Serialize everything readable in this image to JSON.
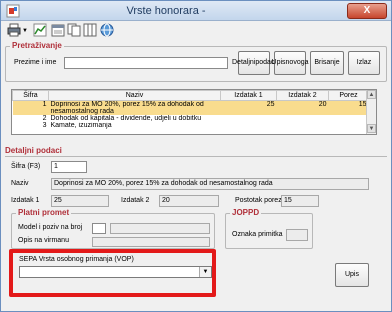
{
  "window": {
    "title": "Vrste honorara -",
    "close_label": "X"
  },
  "toolbar": {
    "icons": [
      "printer-icon",
      "chart-icon",
      "calendar-icon",
      "copy-icon",
      "columns-icon",
      "globe-icon"
    ]
  },
  "search": {
    "group_title": "Pretraživanje",
    "label": "Prezime i ime",
    "value": ""
  },
  "buttons": {
    "details": [
      "Detaljni",
      "podaci"
    ],
    "new_entry": [
      "Upis",
      "novoga"
    ],
    "delete": "Brisanje",
    "exit": "Izlaz",
    "save": "Upis"
  },
  "grid": {
    "columns": [
      "Šifra",
      "Naziv",
      "Izdatak 1",
      "Izdatak 2",
      "Porez"
    ],
    "rows": [
      {
        "sifra": "1",
        "naziv": [
          "Doprinosi za MO 20%, porez 15% za dohodak od",
          "nesamostalnog rada"
        ],
        "izdatak1": "25",
        "izdatak2": "20",
        "porez": "15"
      },
      {
        "sifra": "2",
        "naziv": [
          "Dohodak od kapitala - dividende, udjeli u dobitku"
        ],
        "izdatak1": "",
        "izdatak2": "",
        "porez": ""
      },
      {
        "sifra": "3",
        "naziv": [
          "Kamate, izuzimanja"
        ],
        "izdatak1": "",
        "izdatak2": "",
        "porez": ""
      }
    ]
  },
  "details": {
    "header": "Detaljni podaci",
    "sifra_label": "Šifra (F3)",
    "sifra_value": "1",
    "naziv_label": "Naziv",
    "naziv_value": "Doprinosi za MO 20%, porez 15% za dohodak od nesamostalnog rada",
    "izdatak1_label": "Izdatak 1",
    "izdatak1_value": "25",
    "izdatak2_label": "Izdatak 2",
    "izdatak2_value": "20",
    "postotak_label": "Postotak poreza",
    "postotak_value": "15"
  },
  "platni_promet": {
    "title": "Platni promet",
    "model_label": "Model i poziv na broj",
    "opis_label": "Opis na virmanu"
  },
  "joppd": {
    "title": "JOPPD",
    "oznaka_label": "Oznaka primitka"
  },
  "sepa": {
    "label": "SEPA Vrsta osobnog primanja (VOP)",
    "value": ""
  }
}
